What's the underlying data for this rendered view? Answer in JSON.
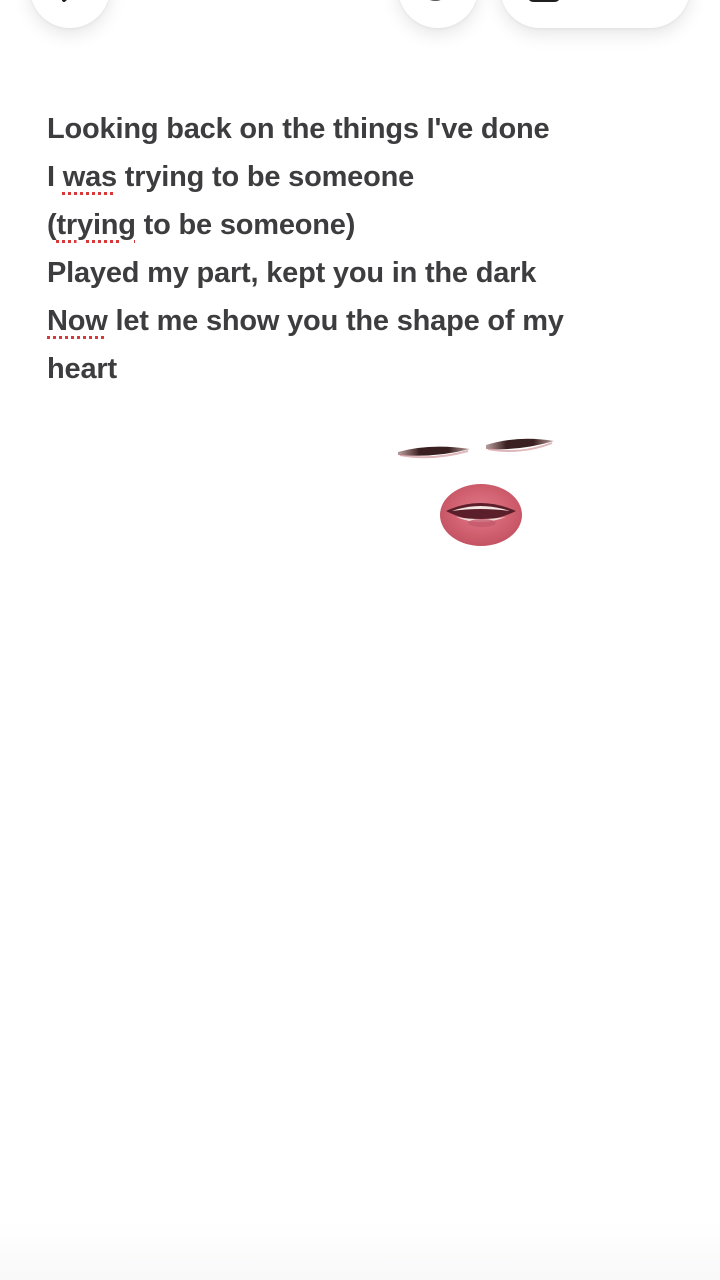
{
  "toolbar": {
    "back_icon": "chevron-left-icon",
    "redo_icon": "redo-icon",
    "pill_icon": "share-icon"
  },
  "note": {
    "lines": [
      {
        "parts": [
          {
            "text": "Looking back on the things I've done"
          }
        ]
      },
      {
        "parts": [
          {
            "text": "I "
          },
          {
            "text": "was",
            "misspelled": true
          },
          {
            "text": " trying to be someone"
          }
        ]
      },
      {
        "parts": [
          {
            "text": "("
          },
          {
            "text": "trying",
            "misspelled": true
          },
          {
            "text": " to be someone)"
          }
        ]
      },
      {
        "parts": [
          {
            "text": "Played my part, kept you in the dark"
          }
        ]
      },
      {
        "parts": [
          {
            "text": "Now",
            "misspelled": true
          },
          {
            "text": " let me show you the shape of my"
          }
        ]
      },
      {
        "parts": [
          {
            "text": "heart"
          }
        ]
      }
    ]
  },
  "colors": {
    "text": "#3d3d3f",
    "spellcheck_underline": "#d9383a",
    "background": "#ffffff"
  }
}
